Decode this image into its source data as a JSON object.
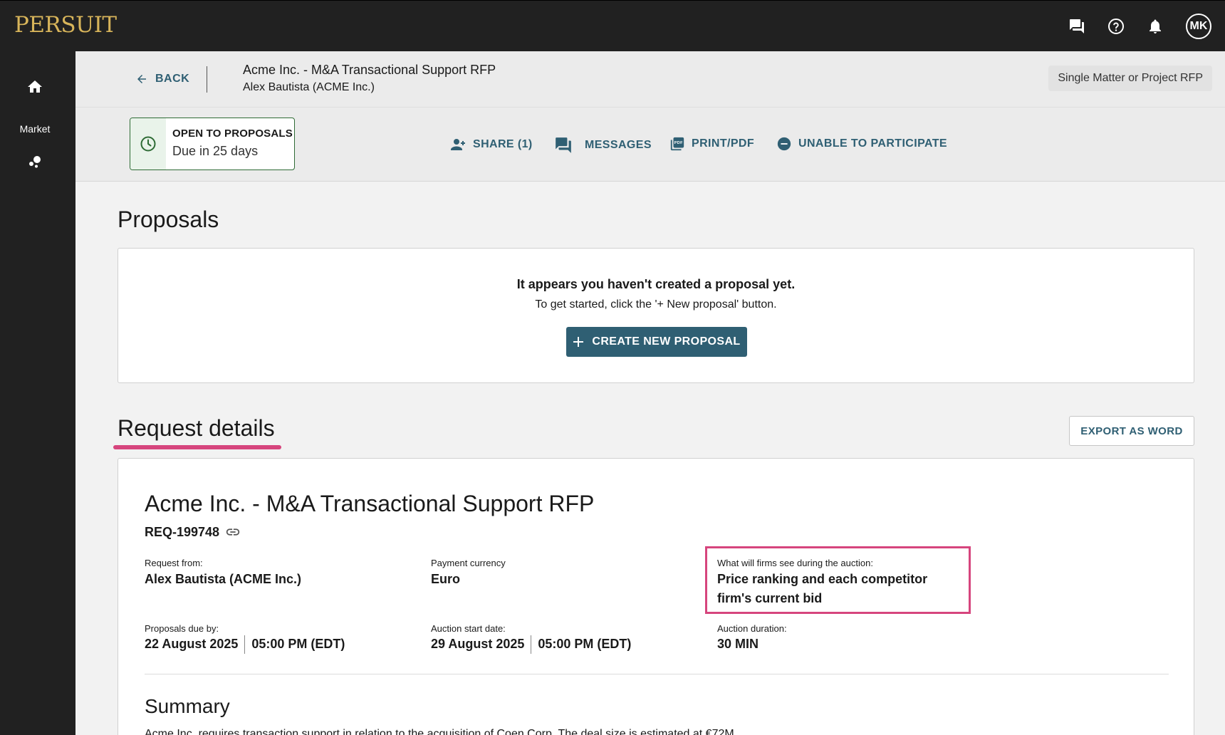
{
  "app": {
    "logo": "PERSUIT"
  },
  "topbar": {
    "icons": [
      "chat-icon",
      "help-icon",
      "notifications-icon"
    ],
    "avatar_initials": "MK"
  },
  "sidebar": {
    "items": [
      {
        "icon": "home-icon",
        "label": ""
      },
      {
        "icon": "market-icon",
        "label": "Market"
      }
    ]
  },
  "header": {
    "back_label": "BACK",
    "rfp_title": "Acme Inc. - M&A Transactional Support RFP",
    "rfp_subtitle": "Alex Bautista (ACME Inc.)",
    "rfp_type": "Single Matter or Project RFP"
  },
  "status": {
    "title": "OPEN TO PROPOSALS",
    "due": "Due in 25 days",
    "accent": "#2e6b35"
  },
  "actions": {
    "share": "SHARE (1)",
    "messages": "MESSAGES",
    "print": "PRINT/PDF",
    "unable": "UNABLE TO PARTICIPATE"
  },
  "proposals": {
    "title": "Proposals",
    "empty_title": "It appears you haven't created a proposal yet.",
    "empty_sub": "To get started, click the '+ New proposal' button.",
    "create_label": "CREATE NEW PROPOSAL"
  },
  "request": {
    "section_title": "Request details",
    "export_label": "EXPORT AS WORD",
    "title": "Acme Inc. - M&A Transactional Support RFP",
    "req_id": "REQ-199748",
    "fields": {
      "request_from_label": "Request from:",
      "request_from_value": "Alex Bautista (ACME Inc.)",
      "currency_label": "Payment currency",
      "currency_value": "Euro",
      "visibility_label": "What will firms see during the auction:",
      "visibility_value": "Price ranking and each competitor firm's current bid",
      "due_label": "Proposals due by:",
      "due_date": "22 August 2025",
      "due_time": "05:00 PM (EDT)",
      "auction_start_label": "Auction start date:",
      "auction_start_date": "29 August 2025",
      "auction_start_time": "05:00 PM (EDT)",
      "duration_label": "Auction duration:",
      "duration_value": "30 MIN"
    },
    "summary_title": "Summary",
    "summary_text": "Acme Inc. requires transaction support in relation to the acquisition of Coen Corp. The deal size is estimated at €72M."
  },
  "colors": {
    "brand_gold": "#d7b45a",
    "primary": "#2f5f73",
    "highlight": "#d6457d",
    "dark": "#212121"
  }
}
